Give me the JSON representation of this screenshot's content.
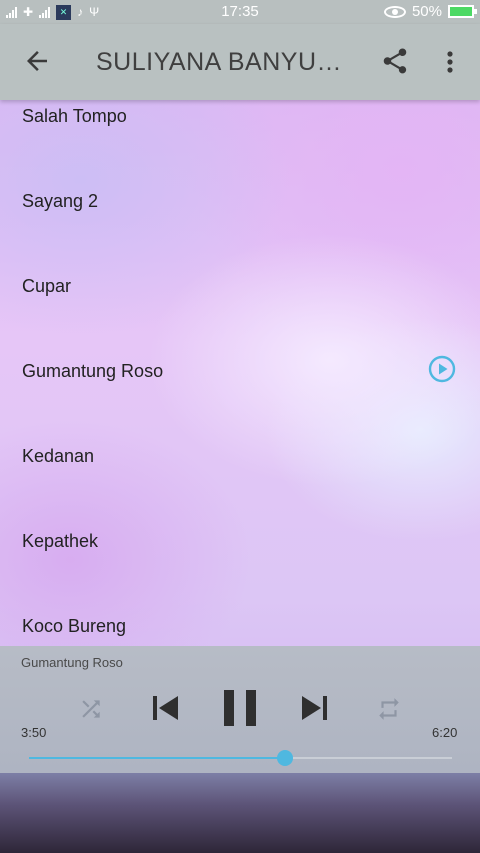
{
  "status_bar": {
    "time": "17:35",
    "battery": "50%"
  },
  "app_bar": {
    "title": "SULIYANA BANYUWANGI",
    "icons": [
      "back-arrow-icon",
      "share-icon",
      "more-vert-icon"
    ]
  },
  "songs": [
    {
      "title": "Salah Tompo",
      "playing": false
    },
    {
      "title": "Sayang 2",
      "playing": false
    },
    {
      "title": "Cupar",
      "playing": false
    },
    {
      "title": "Gumantung Roso",
      "playing": true
    },
    {
      "title": "Kedanan",
      "playing": false
    },
    {
      "title": "Kepathek",
      "playing": false
    },
    {
      "title": "Koco Bureng",
      "playing": false
    }
  ],
  "player": {
    "now_playing": "Gumantung Roso",
    "current_time": "3:50",
    "total_time": "6:20",
    "progress": 0.605,
    "controls": [
      "shuffle-icon",
      "skip-previous-icon",
      "pause-icon",
      "skip-next-icon",
      "repeat-icon"
    ]
  },
  "colors": {
    "accent": "#4fb8e0",
    "app_bar": "#b9c1c1"
  }
}
